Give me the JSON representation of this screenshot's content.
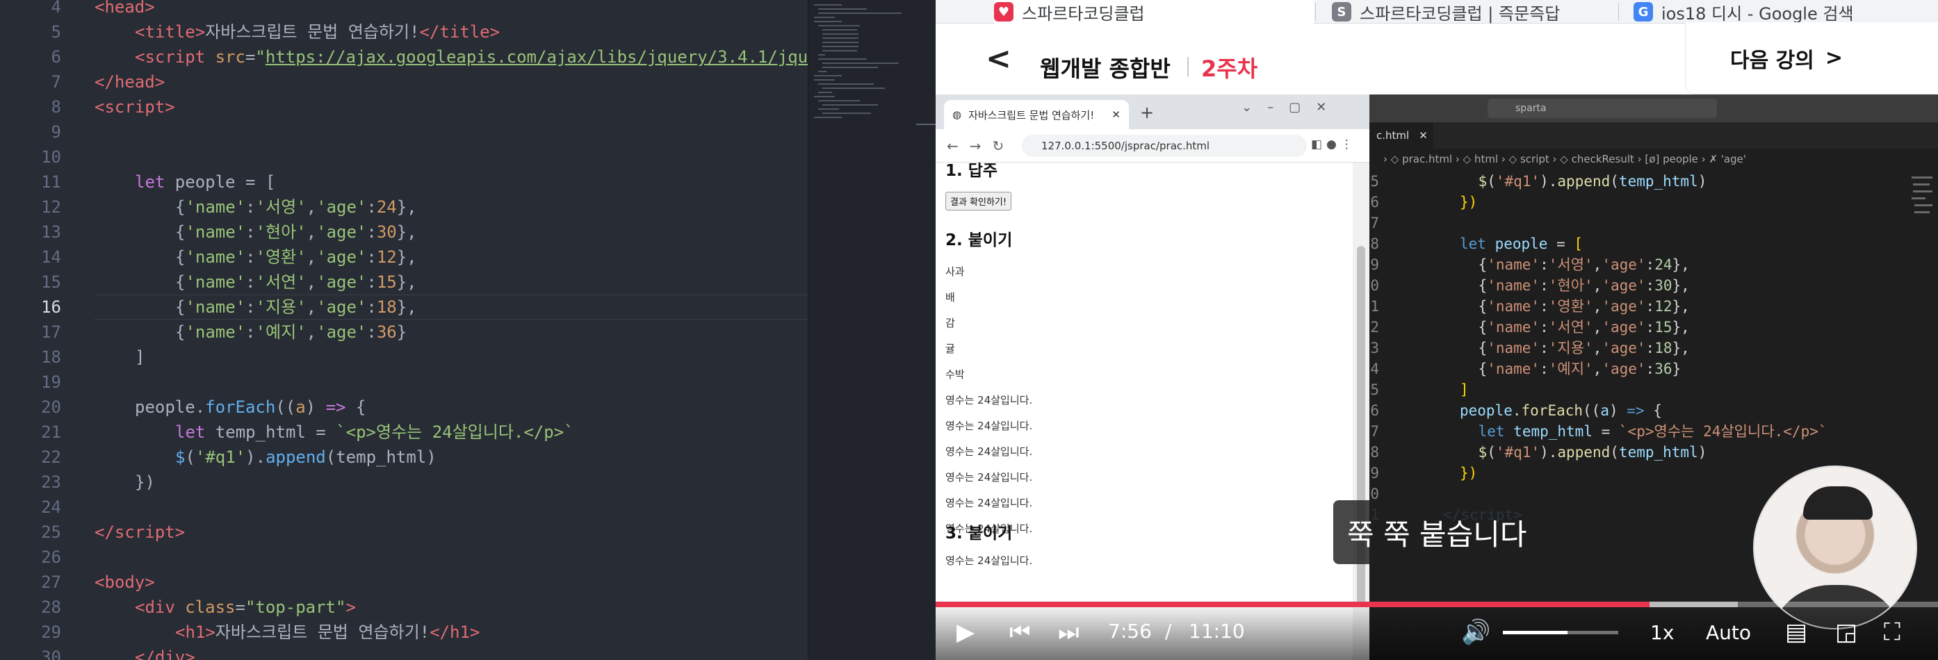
{
  "editor": {
    "lines": [
      {
        "n": "4",
        "html": "<span class='tag'>&lt;head&gt;</span>",
        "indent": 0
      },
      {
        "n": "5",
        "html": "<span class='tag'>&lt;title&gt;</span>자바스크립트 문법 연습하기!<span class='tag'>&lt;/title&gt;</span>",
        "indent": 1
      },
      {
        "n": "6",
        "html": "<span class='tag'>&lt;script</span> <span class='num'>src</span>=<span class='str'>\"</span><span class='link'>https://ajax.googleapis.com/ajax/libs/jquery/3.4.1/jqu</span>",
        "indent": 1
      },
      {
        "n": "7",
        "html": "<span class='tag'>&lt;/head&gt;</span>",
        "indent": 0
      },
      {
        "n": "8",
        "html": "<span class='tag'>&lt;script&gt;</span>",
        "indent": 0
      },
      {
        "n": "9",
        "html": "",
        "indent": 0
      },
      {
        "n": "10",
        "html": "",
        "indent": 0
      },
      {
        "n": "11",
        "html": "<span class='kw'>let</span> people = [",
        "indent": 1
      },
      {
        "n": "12",
        "html": "{<span class='str'>'name'</span>:<span class='str'>'서영'</span>,<span class='str'>'age'</span>:<span class='num'>24</span>},",
        "indent": 2
      },
      {
        "n": "13",
        "html": "{<span class='str'>'name'</span>:<span class='str'>'현아'</span>,<span class='str'>'age'</span>:<span class='num'>30</span>},",
        "indent": 2
      },
      {
        "n": "14",
        "html": "{<span class='str'>'name'</span>:<span class='str'>'영환'</span>,<span class='str'>'age'</span>:<span class='num'>12</span>},",
        "indent": 2
      },
      {
        "n": "15",
        "html": "{<span class='str'>'name'</span>:<span class='str'>'서연'</span>,<span class='str'>'age'</span>:<span class='num'>15</span>},",
        "indent": 2
      },
      {
        "n": "16",
        "html": "{<span class='str'>'name'</span>:<span class='str'>'지용'</span>,<span class='str'>'age'</span>:<span class='num'>18</span>},",
        "indent": 2,
        "current": true
      },
      {
        "n": "17",
        "html": "{<span class='str'>'name'</span>:<span class='str'>'예지'</span>,<span class='str'>'age'</span>:<span class='num'>36</span>}",
        "indent": 2
      },
      {
        "n": "18",
        "html": "]",
        "indent": 1
      },
      {
        "n": "19",
        "html": "",
        "indent": 0
      },
      {
        "n": "20",
        "html": "people.<span class='fn'>forEach</span>((<span class='prm'>a</span>) <span class='kw'>=&gt;</span> {",
        "indent": 1
      },
      {
        "n": "21",
        "html": "<span class='kw'>let</span> temp_html = <span class='str'>`&lt;p&gt;영수는 24살입니다.&lt;/p&gt;`</span>",
        "indent": 2
      },
      {
        "n": "22",
        "html": "<span class='fn'>$</span>(<span class='str'>'#q1'</span>).<span class='fn'>append</span>(temp_html)",
        "indent": 2
      },
      {
        "n": "23",
        "html": "})",
        "indent": 1
      },
      {
        "n": "24",
        "html": "",
        "indent": 0
      },
      {
        "n": "25",
        "html": "<span class='tag'>&lt;/script&gt;</span>",
        "indent": 0
      },
      {
        "n": "26",
        "html": "",
        "indent": 0
      },
      {
        "n": "27",
        "html": "<span class='tag'>&lt;body&gt;</span>",
        "indent": 0
      },
      {
        "n": "28",
        "html": "<span class='tag'>&lt;div</span> <span class='num'>class</span>=<span class='str'>\"top-part\"</span><span class='tag'>&gt;</span>",
        "indent": 1
      },
      {
        "n": "29",
        "html": "<span class='tag'>&lt;h1&gt;</span>자바스크립트 문법 연습하기!<span class='tag'>&lt;/h1&gt;</span>",
        "indent": 2
      },
      {
        "n": "30",
        "html": "<span class='tag'>&lt;/div&gt;</span>",
        "indent": 1
      }
    ]
  },
  "browser_tabs": [
    {
      "label": "스파르타코딩클럽",
      "icon": "sparta-logo-icon",
      "color": "#e8344e",
      "glyph": "♥",
      "active": true
    },
    {
      "label": "스파르타코딩클럽 | 즉문즉답",
      "icon": "s-logo-icon",
      "color": "#7b7f85",
      "glyph": "S",
      "active": false
    },
    {
      "label": "ios18 디시 - Google 검색",
      "icon": "google-logo-icon",
      "color": "#4285f4",
      "glyph": "G",
      "active": false
    }
  ],
  "lecture": {
    "course_title": "웹개발 종합반",
    "week": "2주차",
    "next_label": "다음 강의",
    "back_glyph": "<",
    "next_glyph": ">"
  },
  "video": {
    "inner_browser": {
      "tab_title": "자바스크립트 문법 연습하기!",
      "url": "127.0.0.1:5500/jsprac/prac.html",
      "heading1": "1. 답주",
      "result_button": "결과 확인하기!",
      "heading2": "2. 붙이기",
      "fruits": [
        "사과",
        "배",
        "감",
        "귤",
        "수박"
      ],
      "sentences": [
        "영수는 24살입니다.",
        "영수는 24살입니다.",
        "영수는 24살입니다.",
        "영수는 24살입니다.",
        "영수는 24살입니다.",
        "영수는 24살입니다."
      ],
      "heading3": "3. 붙이기",
      "sentence_last": "영수는 24살입니다."
    },
    "vscode": {
      "search": "sparta",
      "tab": "c.html",
      "breadcrumb": "› ◇ prac.html › ◇ html › ◇ script › ◇ checkResult › [ø] people › ✗ 'age'",
      "lines": [
        {
          "n": "5",
          "html": "    <span class='v-fn'>$</span>(<span class='v-str'>'#q1'</span>).<span class='v-fn'>append</span>(<span class='v-var'>temp_html</span>)"
        },
        {
          "n": "6",
          "html": "<span class='v-pun'>})</span>"
        },
        {
          "n": "7",
          "html": ""
        },
        {
          "n": "8",
          "html": "<span class='v-kw'>let</span> <span class='v-var'>people</span> = <span class='v-pun'>[</span>"
        },
        {
          "n": "9",
          "html": "    {<span class='v-str'>'name'</span>:<span class='v-str'>'서영'</span>,<span class='v-str'>'age'</span>:<span class='v-num'>24</span>},"
        },
        {
          "n": "0",
          "html": "    {<span class='v-str'>'name'</span>:<span class='v-str'>'현아'</span>,<span class='v-str'>'age'</span>:<span class='v-num'>30</span>},"
        },
        {
          "n": "1",
          "html": "    {<span class='v-str'>'name'</span>:<span class='v-str'>'영환'</span>,<span class='v-str'>'age'</span>:<span class='v-num'>12</span>},"
        },
        {
          "n": "2",
          "html": "    {<span class='v-str'>'name'</span>:<span class='v-str'>'서연'</span>,<span class='v-str'>'age'</span>:<span class='v-num'>15</span>},"
        },
        {
          "n": "3",
          "html": "    {<span class='v-str'>'name'</span>:<span class='v-str'>'지용'</span>,<span class='v-str'>'age'</span>:<span class='v-num'>18</span>},"
        },
        {
          "n": "4",
          "html": "    {<span class='v-str'>'name'</span>:<span class='v-str'>'예지'</span>,<span class='v-str'>'age'</span>:<span class='v-num'>36</span>}"
        },
        {
          "n": "5",
          "html": "<span class='v-pun'>]</span>"
        },
        {
          "n": "6",
          "html": "<span class='v-var'>people</span>.<span class='v-fn'>forEach</span>((<span class='v-var'>a</span>) <span class='v-kw'>=&gt;</span> {"
        },
        {
          "n": "7",
          "html": "    <span class='v-kw'>let</span> <span class='v-var'>temp_html</span> = <span class='v-str'>`&lt;p&gt;영수는 24살입니다.&lt;/p&gt;`</span>"
        },
        {
          "n": "8",
          "html": "    <span class='v-fn'>$</span>(<span class='v-str'>'#q1'</span>).<span class='v-fn'>append</span>(<span class='v-var'>temp_html</span>)"
        },
        {
          "n": "9",
          "html": "<span class='v-pun'>})</span>"
        },
        {
          "n": "0",
          "html": ""
        },
        {
          "n": "1",
          "html": "<span class='v-tag'>&lt;/script&gt;</span>"
        }
      ]
    },
    "caption": "쭉 쭉 붙습니다",
    "current_time": "7:56",
    "time_sep": "/",
    "duration": "11:10",
    "progress_fraction": 0.7125,
    "buffered_fraction": 0.8,
    "volume_fraction": 0.56,
    "speed": "1x",
    "quality": "Auto"
  },
  "colors": {
    "accent": "#e8344e"
  }
}
